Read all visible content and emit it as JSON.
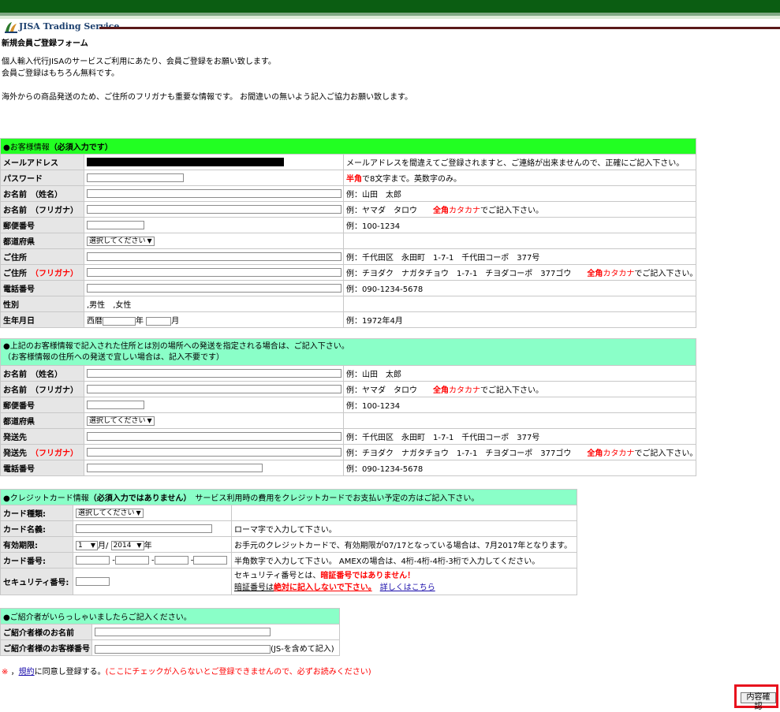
{
  "brand": {
    "name": "JISA Trading Service",
    "colors": {
      "header": "#0b5d12",
      "section_green": "#22ff22",
      "section_mint": "#8affc8",
      "accent_red": "#ff0000"
    }
  },
  "page": {
    "title": "新規会員ご登録フォーム",
    "intro1": "個人輸入代行JISAのサービスご利用にあたり、会員ご登録をお願い致します。",
    "intro2": "会員ご登録はもちろん無料です。",
    "intro3": "海外からの商品発送のため、ご住所のフリガナも重要な情報です。 お間違いの無いよう記入ご協力お願い致します。"
  },
  "customer": {
    "header": "●お客様情報",
    "header_required": "（必須入力です）",
    "email_label": "メールアドレス",
    "email_note": "メールアドレスを間違えてご登録されますと、ご連絡が出来ませんので、正確にご記入下さい。",
    "password_label": "パスワード",
    "password_note_red": "半角",
    "password_note": "で8文字まで。英数字のみ。",
    "name_label": "お名前　（姓名）",
    "name_example": "例：山田　太郎",
    "kana_label": "お名前　（フリガナ）",
    "kana_example": "例：ヤマダ　タロウ　",
    "kana_red1": "全角",
    "kana_red2": "カタカナ",
    "kana_note": "でご記入下さい。",
    "zip_label": "郵便番号",
    "zip_example": "例：100-1234",
    "pref_label": "都道府県",
    "pref_select": "選択してください",
    "address_label": "ご住所",
    "address_example": "例：千代田区　永田町　1-7-1　千代田コーポ　377号",
    "address_kana_label": "ご住所",
    "address_kana_red": "（フリガナ）",
    "address_kana_example": "例：チヨダク　ナガタチョウ　1-7-1　チヨダコーポ　377ゴウ　",
    "phone_label": "電話番号",
    "phone_example": "例：090-1234-5678",
    "gender_label": "性別",
    "gender_male": ",男性",
    "gender_female": ",女性",
    "birth_label": "生年月日",
    "birth_prefix": "西暦",
    "birth_year_unit": "年",
    "birth_month_unit": "月",
    "birth_example": "例：1972年4月"
  },
  "shipping": {
    "header_line1": "●上記のお客様情報で記入された住所とは別の場所への発送を指定される場合は、ご記入下さい。",
    "header_line2": "（お客様情報の住所への発送で宜しい場合は、記入不要です）",
    "name_label": "お名前　（姓名）",
    "kana_label": "お名前　（フリガナ）",
    "zip_label": "郵便番号",
    "pref_label": "都道府県",
    "dest_label": "発送先",
    "dest_kana_label": "発送先",
    "dest_kana_red": "（フリガナ）",
    "phone_label": "電話番号"
  },
  "card": {
    "header": "●クレジットカード情報",
    "header_bold": "（必須入力ではありません）",
    "header_note": "　サービス利用時の費用をクレジットカードでお支払い予定の方はご記入下さい。",
    "type_label": "カード種類:",
    "type_select": "選択してください",
    "name_label": "カード名義:",
    "name_note": "ローマ字で入力して下さい。",
    "expiry_label": "有効期限:",
    "expiry_month": "1",
    "expiry_month_unit": "月/",
    "expiry_year": "2014",
    "expiry_year_unit": "年",
    "expiry_note": "お手元のクレジットカードで、有効期限が07/17となっている場合は、7月2017年となります。",
    "number_label": "カード番号:",
    "number_sep": "-",
    "number_note": "半角数字で入力して下さい。 AMEXの場合は、4桁-4桁-4桁-3桁で入力してください。",
    "security_label": "セキュリティ番号:",
    "security_note1": "セキュリティ番号とは、",
    "security_note1_red": "暗証番号ではありません！",
    "security_note2a": "暗証番号は",
    "security_note2_red": "絶対に記入しないで下さい。",
    "security_link": "詳しくはこちら"
  },
  "referrer": {
    "header": "●ご紹介者がいらっしゃいましたらご記入ください。",
    "name_label": "ご紹介者様のお名前",
    "number_label": "ご紹介者様のお客様番号",
    "number_note": "(JS-を含めて記入)"
  },
  "agreement": {
    "mark": "※",
    "sep": "，",
    "terms_link": "規約",
    "text": "に同意し登録する。",
    "warning": "(ここにチェックが入らないとご登録できませんので、必ずお読みください)"
  },
  "submit": {
    "label": "内容確認"
  }
}
